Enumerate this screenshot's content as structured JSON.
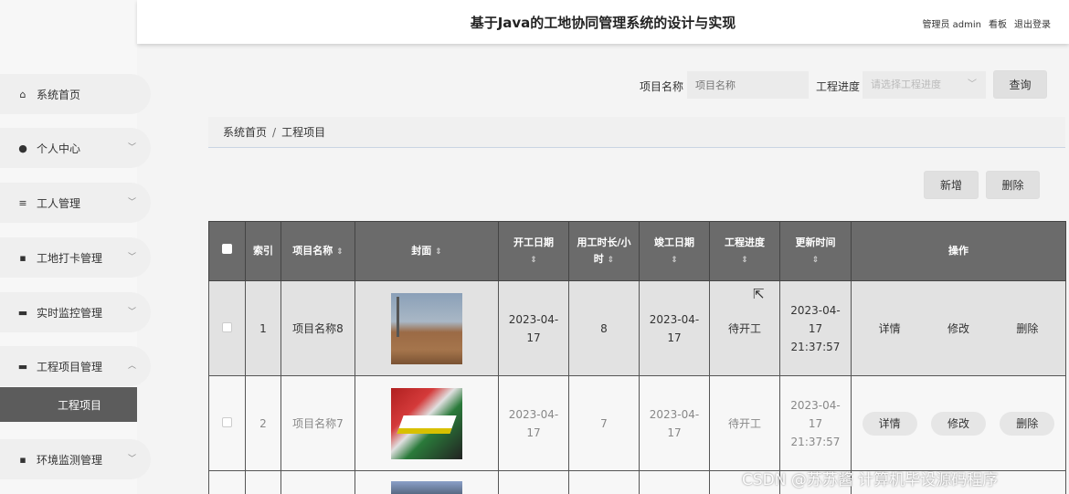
{
  "header": {
    "title": "基于Java的工地协同管理系统的设计与实现",
    "admin": "管理员 admin",
    "board": "看板",
    "logout": "退出登录"
  },
  "sidebar": {
    "items": [
      {
        "label": "系统首页",
        "icon": "home-icon",
        "glyph": "⌂"
      },
      {
        "label": "个人中心",
        "icon": "user-icon",
        "glyph": "●"
      },
      {
        "label": "工人管理",
        "icon": "list-icon",
        "glyph": "≡"
      },
      {
        "label": "工地打卡管理",
        "icon": "grid-icon",
        "glyph": "▪"
      },
      {
        "label": "实时监控管理",
        "icon": "comment-icon",
        "glyph": "▬"
      },
      {
        "label": "工程项目管理",
        "icon": "briefcase-icon",
        "glyph": "▬"
      },
      {
        "label": "环境监测管理",
        "icon": "grid-icon",
        "glyph": "▪"
      }
    ],
    "active_sub": "工程项目"
  },
  "search": {
    "name_label": "项目名称",
    "name_placeholder": "项目名称",
    "progress_label": "工程进度",
    "progress_placeholder": "请选择工程进度",
    "query": "查询"
  },
  "breadcrumb": {
    "home": "系统首页",
    "sep": "/",
    "current": "工程项目"
  },
  "actions": {
    "add": "新增",
    "delete": "删除"
  },
  "table": {
    "headers": {
      "index": "索引",
      "name": "项目名称",
      "cover": "封面",
      "start_date": "开工日期",
      "hours": "用工时长/小时",
      "end_date": "竣工日期",
      "progress": "工程进度",
      "updated": "更新时间",
      "ops": "操作"
    },
    "rows": [
      {
        "index": "1",
        "name": "项目名称8",
        "start": "2023-04-17",
        "hours": "8",
        "end": "2023-04-17",
        "progress": "待开工",
        "updated": "2023-04-17 21:37:57"
      },
      {
        "index": "2",
        "name": "项目名称7",
        "start": "2023-04-17",
        "hours": "7",
        "end": "2023-04-17",
        "progress": "待开工",
        "updated": "2023-04-17 21:37:57"
      }
    ],
    "op_labels": {
      "detail": "详情",
      "edit": "修改",
      "delete": "删除"
    }
  },
  "watermark": "CSDN @苏苏酱    计算机毕设源码程序"
}
